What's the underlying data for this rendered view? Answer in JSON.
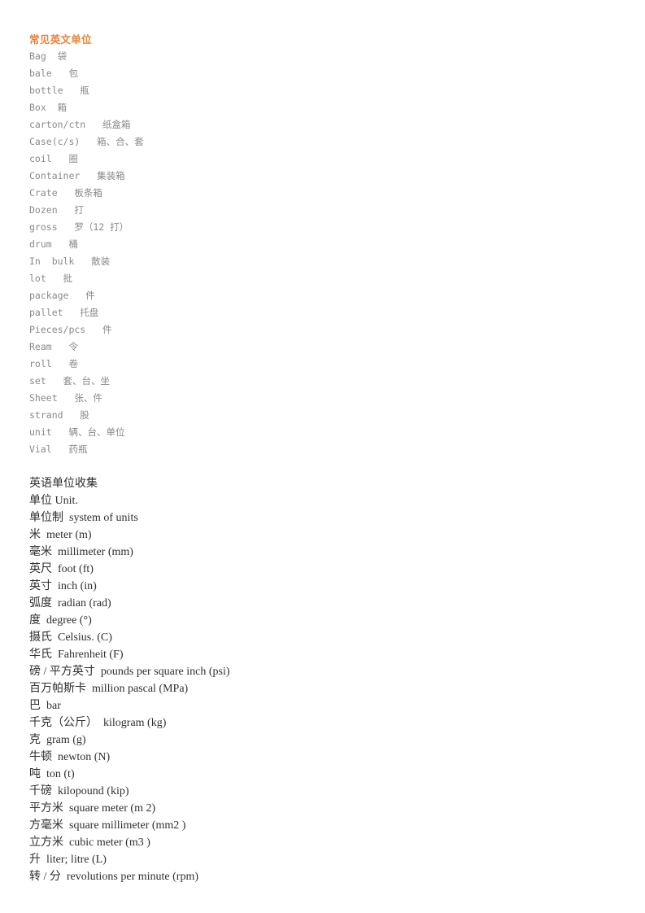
{
  "document": {
    "title": "常见英文单位",
    "title_color": "#E8833C",
    "background_color": "#FFFFFF",
    "section1_text_color": "#8A8A8A",
    "section2_text_color": "#2F2F2F"
  },
  "section1": {
    "heading": "常见英文单位",
    "items": [
      "Bag  袋",
      "bale   包",
      "bottle   瓶",
      "Box  箱",
      "carton/ctn   纸盒箱",
      "Case(c/s)   箱、合、套",
      "coil   圈",
      "Container   集装箱",
      "Crate   板条箱",
      "Dozen   打",
      "gross   罗（12 打）",
      "drum   桶",
      "In  bulk   散装",
      "lot   批",
      "package   件",
      "pallet   托盘",
      "Pieces/pcs   件",
      "Ream   令",
      "roll   卷",
      "set   套、台、坐",
      "Sheet   张、件",
      "strand   股",
      "unit   辆、台、单位",
      "Vial   药瓶"
    ]
  },
  "section2": {
    "heading": "英语单位收集",
    "items": [
      "单位 Unit.",
      "单位制  system of units",
      "米  meter (m)",
      "毫米  millimeter (mm)",
      "英尺  foot (ft)",
      "英寸  inch (in)",
      "弧度  radian (rad)",
      "度  degree (°)",
      "摄氏  Celsius. (C)",
      "华氏  Fahrenheit (F)",
      "磅 / 平方英寸  pounds per square inch (psi)",
      "百万帕斯卡  million pascal (MPa)",
      "巴  bar",
      "千克（公斤）  kilogram (kg)",
      "克  gram (g)",
      "牛顿  newton (N)",
      "吨  ton (t)",
      "千磅  kilopound (kip)",
      "平方米  square meter (m 2)",
      "方毫米  square millimeter (mm2 )",
      "立方米  cubic meter (m3 )",
      "升  liter; litre (L)",
      "转 / 分  revolutions per minute (rpm)"
    ]
  }
}
